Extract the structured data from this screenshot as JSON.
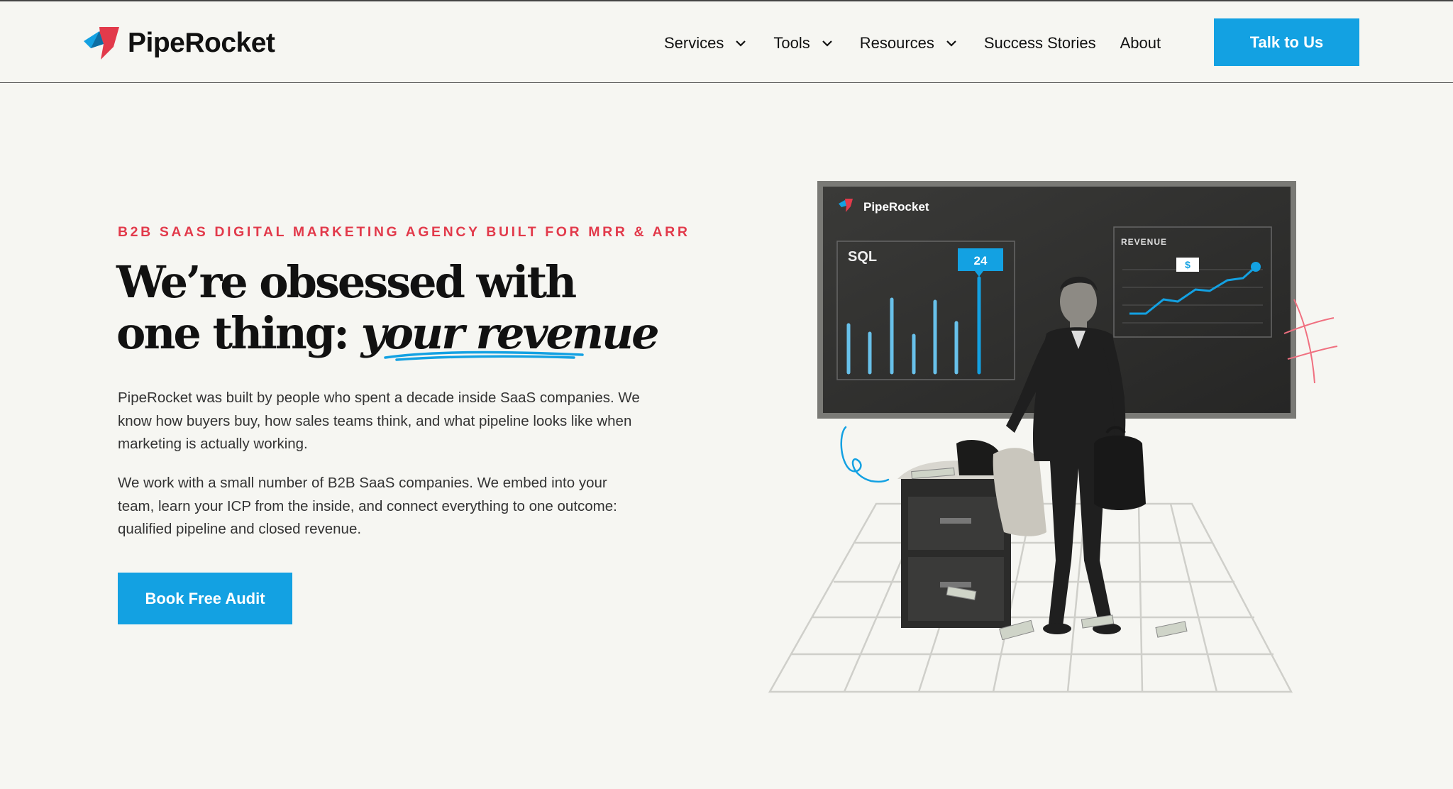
{
  "brand": {
    "name": "PipeRocket",
    "colors": {
      "accent": "#13a1e2",
      "red": "#e23a4b",
      "background": "#f6f6f2"
    }
  },
  "nav": {
    "items": [
      {
        "label": "Services",
        "dropdown": true
      },
      {
        "label": "Tools",
        "dropdown": true
      },
      {
        "label": "Resources",
        "dropdown": true
      },
      {
        "label": "Success Stories",
        "dropdown": false
      },
      {
        "label": "About",
        "dropdown": false
      }
    ],
    "cta_label": "Talk to Us"
  },
  "hero": {
    "eyebrow": "B2B SAAS DIGITAL MARKETING AGENCY BUILT FOR MRR & ARR",
    "headline_line1": "We’re obsessed with",
    "headline_line2_plain": "one thing: ",
    "headline_line2_em": "your revenue",
    "paragraph1": "PipeRocket was built by people who spent a decade inside SaaS companies. We know how buyers buy, how sales teams think, and what pipeline looks like when marketing is actually working.",
    "paragraph2": "We work with a small number of B2B SaaS companies. We embed into your team, learn your ICP from the inside, and connect everything to one outcome: qualified pipeline and closed revenue.",
    "cta_label": "Book Free Audit"
  },
  "illustration": {
    "board_brand": "PipeRocket",
    "sql_label": "SQL",
    "sql_badge": "24",
    "revenue_label": "REVENUE",
    "revenue_badge": "$",
    "icons": [
      "rocket-logo-icon",
      "businessman-figure",
      "file-cabinet",
      "briefcase",
      "chalkboard"
    ]
  }
}
